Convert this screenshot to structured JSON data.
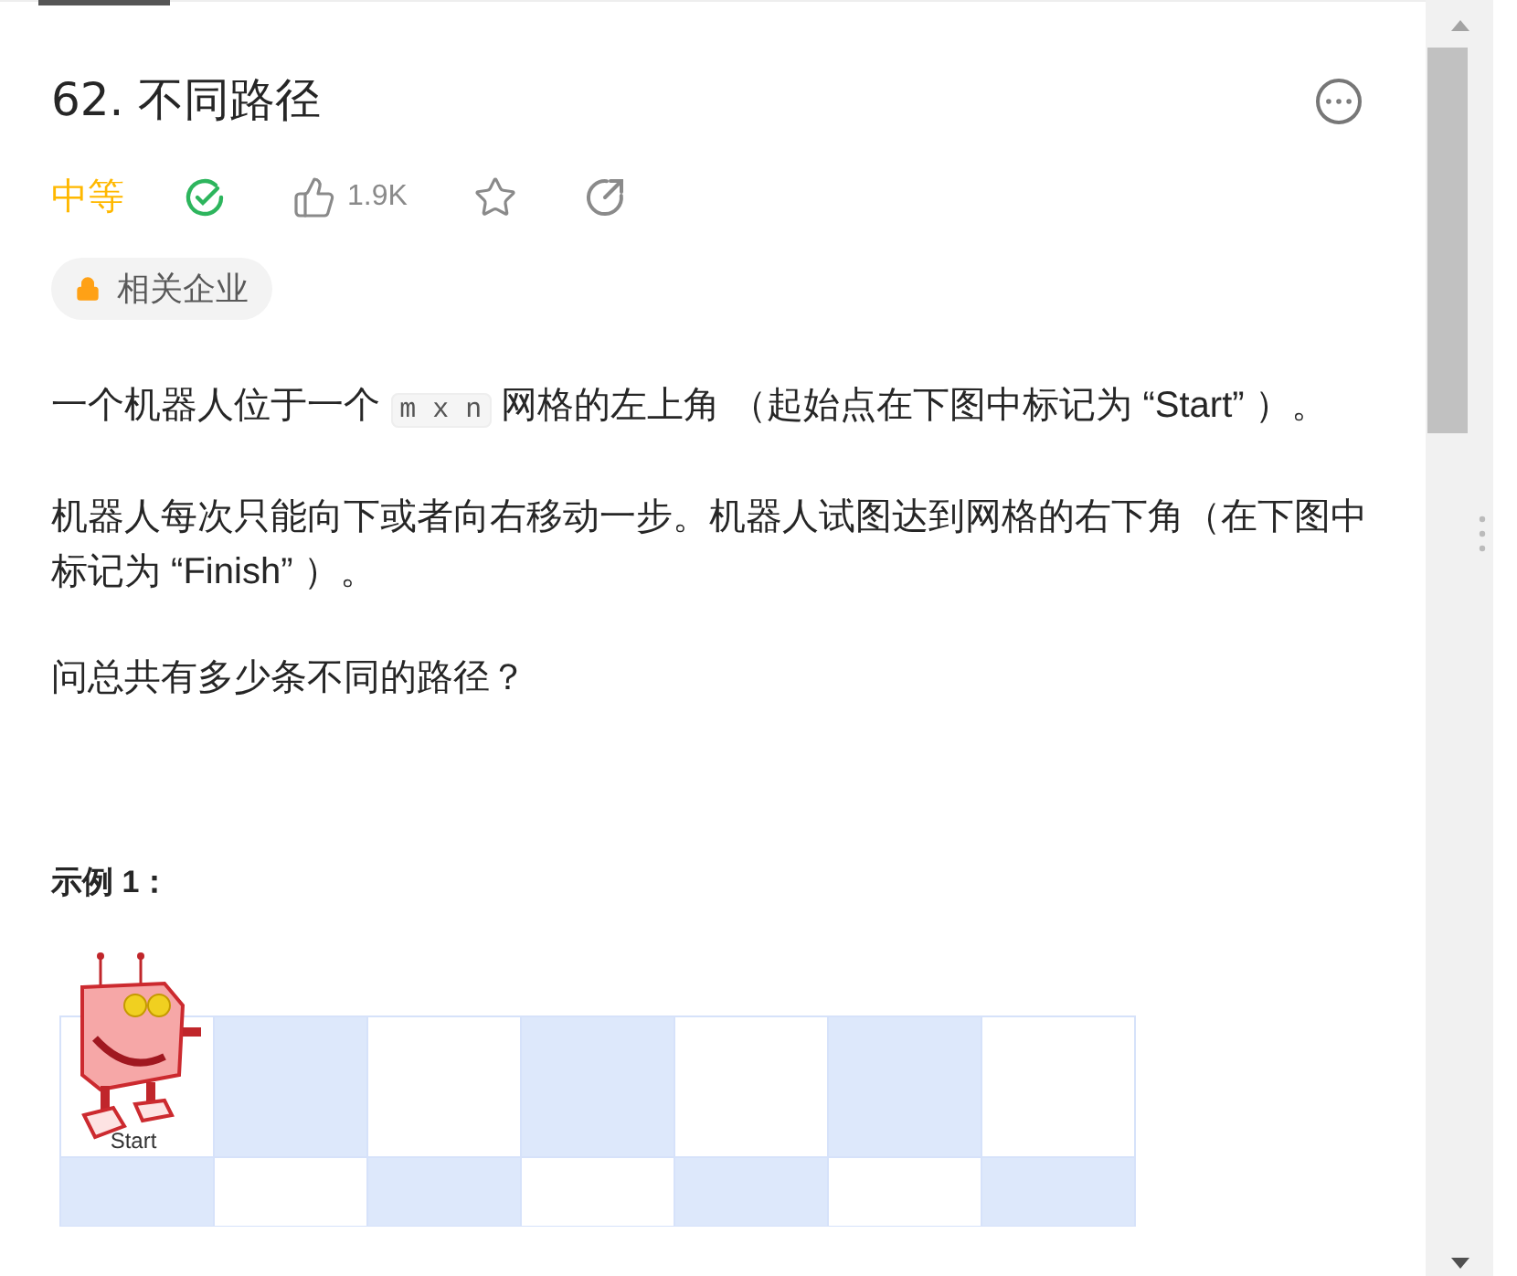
{
  "title": "62. 不同路径",
  "difficulty": "中等",
  "solved": true,
  "likes": "1.9K",
  "starred": false,
  "tag": "相关企业",
  "paragraphs": [
    {
      "before": "一个机器人位于一个 ",
      "code": "m x n",
      "after": " 网格的左上角 （起始点在下图中标记为 “Start” ）。"
    },
    {
      "before": "机器人每次只能向下或者向右移动一步。机器人试图达到网格的右下角（在下图中标记为 “Finish” ）。"
    },
    {
      "before": "问总共有多少条不同的路径？"
    }
  ],
  "example_heading": "示例 1：",
  "figure": {
    "start_label": "Start"
  }
}
